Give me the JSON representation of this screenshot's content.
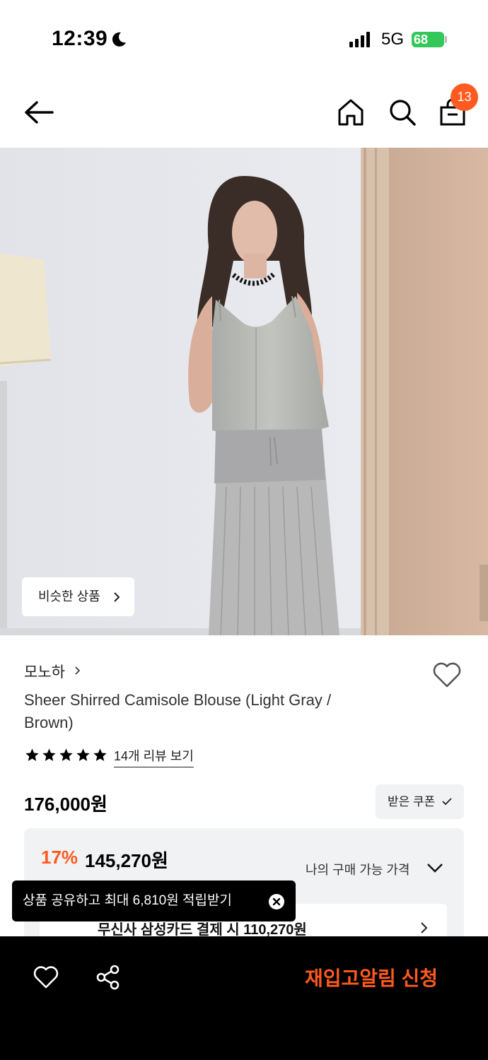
{
  "status_bar": {
    "time": "12:39",
    "network": "5G",
    "battery": "68"
  },
  "header": {
    "back_icon": "arrow-left-icon",
    "home_icon": "home-icon",
    "search_icon": "search-icon",
    "cart_icon": "shopping-bag-icon",
    "cart_count": "13"
  },
  "hero": {
    "similar_products_label": "비슷한 상품"
  },
  "product": {
    "brand": "모노하",
    "title": "Sheer Shirred Camisole Blouse (Light Gray / Brown)",
    "rating_stars": 5,
    "review_link": "14개 리뷰 보기",
    "price": "176,000원",
    "coupon_button": "받은 쿠폰"
  },
  "price_box": {
    "discount_rate": "17%",
    "discount_price": "145,270원",
    "my_price_label": "나의 구매 가능 가격",
    "card_offer": "무신사 삼성카드 결제 시 110,270원"
  },
  "toast": {
    "text": "상품 공유하고 최대 6,810원 적립받기"
  },
  "bottom_bar": {
    "restock_label": "재입고알림 신청"
  },
  "colors": {
    "accent": "#ff5a1f",
    "badge": "#ff5a1f",
    "battery": "#34c759",
    "bottom_bar": "#000000",
    "price_box_bg": "#f1f2f4"
  }
}
